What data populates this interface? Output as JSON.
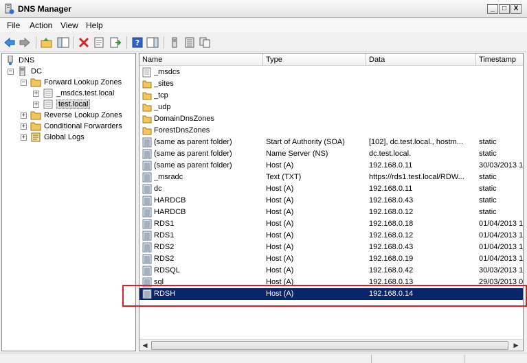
{
  "window": {
    "title": "DNS Manager",
    "min_label": "_",
    "max_label": "□",
    "close_label": "X"
  },
  "menu": {
    "items": [
      "File",
      "Action",
      "View",
      "Help"
    ]
  },
  "toolbar": {
    "icons": [
      "back-arrow-icon",
      "forward-arrow-icon",
      "up-folder-icon",
      "show-hide-tree-icon",
      "delete-icon",
      "properties-icon",
      "export-list-icon",
      "help-icon",
      "show-hide-action-pane-icon",
      "server-icon",
      "record-list-icon",
      "copy-record-icon"
    ]
  },
  "tree": {
    "root": "DNS",
    "server": "DC",
    "forward_zones": "Forward Lookup Zones",
    "msdcs_zone": "_msdcs.test.local",
    "test_zone": "test.local",
    "reverse_zones": "Reverse Lookup Zones",
    "conditional_forwarders": "Conditional Forwarders",
    "global_logs": "Global Logs",
    "expand_plus": "+",
    "expand_minus": "−"
  },
  "list": {
    "columns": [
      "Name",
      "Type",
      "Data",
      "Timestamp"
    ],
    "rows": [
      {
        "name": "_msdcs",
        "type": "",
        "data": "",
        "timestamp": "",
        "icon": "zone-icon"
      },
      {
        "name": "_sites",
        "type": "",
        "data": "",
        "timestamp": "",
        "icon": "folder-icon"
      },
      {
        "name": "_tcp",
        "type": "",
        "data": "",
        "timestamp": "",
        "icon": "folder-icon"
      },
      {
        "name": "_udp",
        "type": "",
        "data": "",
        "timestamp": "",
        "icon": "folder-icon"
      },
      {
        "name": "DomainDnsZones",
        "type": "",
        "data": "",
        "timestamp": "",
        "icon": "folder-icon"
      },
      {
        "name": "ForestDnsZones",
        "type": "",
        "data": "",
        "timestamp": "",
        "icon": "folder-icon"
      },
      {
        "name": "(same as parent folder)",
        "type": "Start of Authority (SOA)",
        "data": "[102], dc.test.local., hostm...",
        "timestamp": "static",
        "icon": "record-icon"
      },
      {
        "name": "(same as parent folder)",
        "type": "Name Server (NS)",
        "data": "dc.test.local.",
        "timestamp": "static",
        "icon": "record-icon"
      },
      {
        "name": "(same as parent folder)",
        "type": "Host (A)",
        "data": "192.168.0.11",
        "timestamp": "30/03/2013 1",
        "icon": "record-icon"
      },
      {
        "name": "_msradc",
        "type": "Text (TXT)",
        "data": "https://rds1.test.local/RDW...",
        "timestamp": "static",
        "icon": "record-icon"
      },
      {
        "name": "dc",
        "type": "Host (A)",
        "data": "192.168.0.11",
        "timestamp": "static",
        "icon": "record-icon"
      },
      {
        "name": "HARDCB",
        "type": "Host (A)",
        "data": "192.168.0.43",
        "timestamp": "static",
        "icon": "record-icon"
      },
      {
        "name": "HARDCB",
        "type": "Host (A)",
        "data": "192.168.0.12",
        "timestamp": "static",
        "icon": "record-icon"
      },
      {
        "name": "RDS1",
        "type": "Host (A)",
        "data": "192.168.0.18",
        "timestamp": "01/04/2013 1",
        "icon": "record-icon"
      },
      {
        "name": "RDS1",
        "type": "Host (A)",
        "data": "192.168.0.12",
        "timestamp": "01/04/2013 1",
        "icon": "record-icon"
      },
      {
        "name": "RDS2",
        "type": "Host (A)",
        "data": "192.168.0.43",
        "timestamp": "01/04/2013 1",
        "icon": "record-icon"
      },
      {
        "name": "RDS2",
        "type": "Host (A)",
        "data": "192.168.0.19",
        "timestamp": "01/04/2013 1",
        "icon": "record-icon"
      },
      {
        "name": "RDSQL",
        "type": "Host (A)",
        "data": "192.168.0.42",
        "timestamp": "30/03/2013 1",
        "icon": "record-icon"
      },
      {
        "name": "sql",
        "type": "Host (A)",
        "data": "192.168.0.13",
        "timestamp": "29/03/2013 0",
        "icon": "record-icon"
      },
      {
        "name": "RDSH",
        "type": "Host (A)",
        "data": "192.168.0.14",
        "timestamp": "",
        "icon": "record-icon",
        "selected": true
      }
    ]
  },
  "scrollbar": {
    "left_arrow": "◀",
    "right_arrow": "▶"
  },
  "colors": {
    "selection": "#0a246a",
    "highlight_box": "#d81f2a"
  }
}
